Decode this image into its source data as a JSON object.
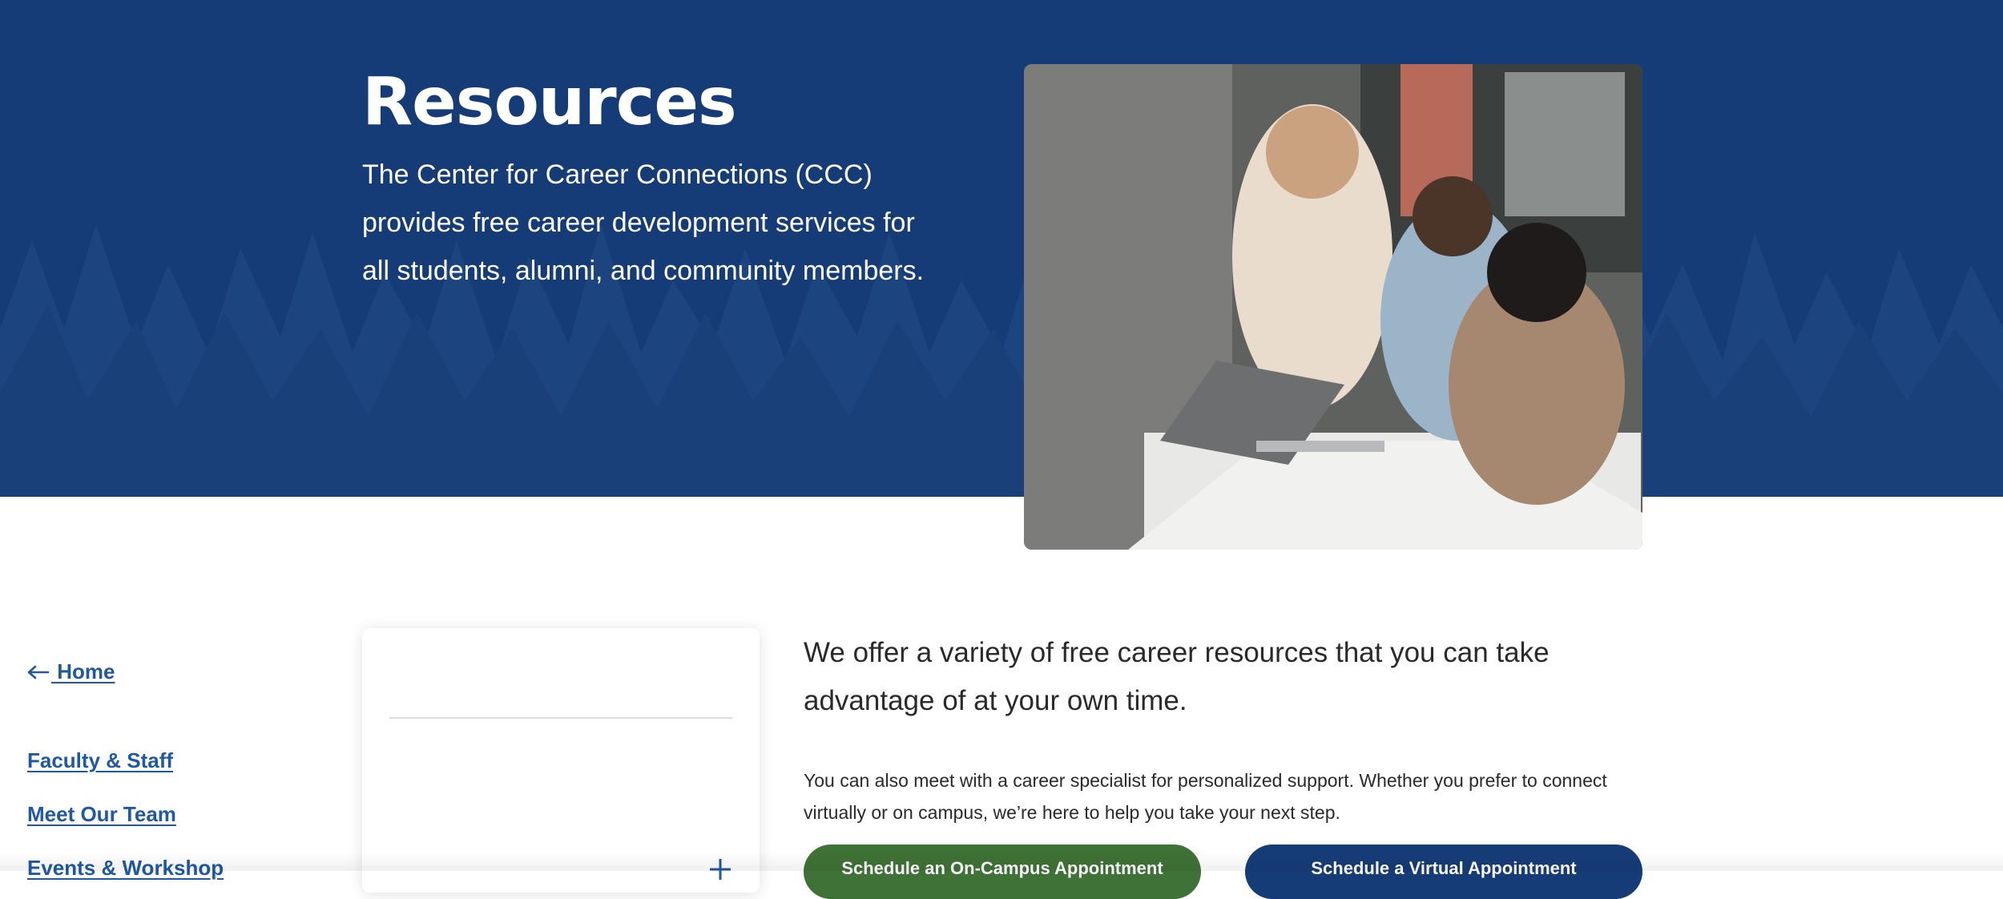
{
  "hero": {
    "title": "Resources",
    "description": "The Center for Career Connections (CCC) provides free career development services for all students, alumni, and community members.",
    "background_color": "#163c78",
    "photo_icon": "office-team-photo"
  },
  "sidebar": {
    "home": {
      "icon": "arrow-left-icon",
      "label": " Home"
    },
    "items": [
      {
        "label": "Faculty & Staff"
      },
      {
        "label": "Meet Our Team"
      },
      {
        "label": "Events & Workshop",
        "icon": "plus-icon"
      }
    ],
    "link_color": "#1f58a3"
  },
  "main": {
    "lead": "We offer a variety of free career resources that you can take advantage of at your own time.",
    "body": "You can also meet with a career specialist for personalized support. Whether you prefer to connect virtually or on campus, we’re here to help you take your next step.",
    "buttons": {
      "on_campus": "Schedule an On-Campus Appointment",
      "virtual": "Schedule a Virtual Appointment"
    },
    "colors": {
      "green_button": "#3f7236",
      "blue_button": "#163c78"
    }
  }
}
